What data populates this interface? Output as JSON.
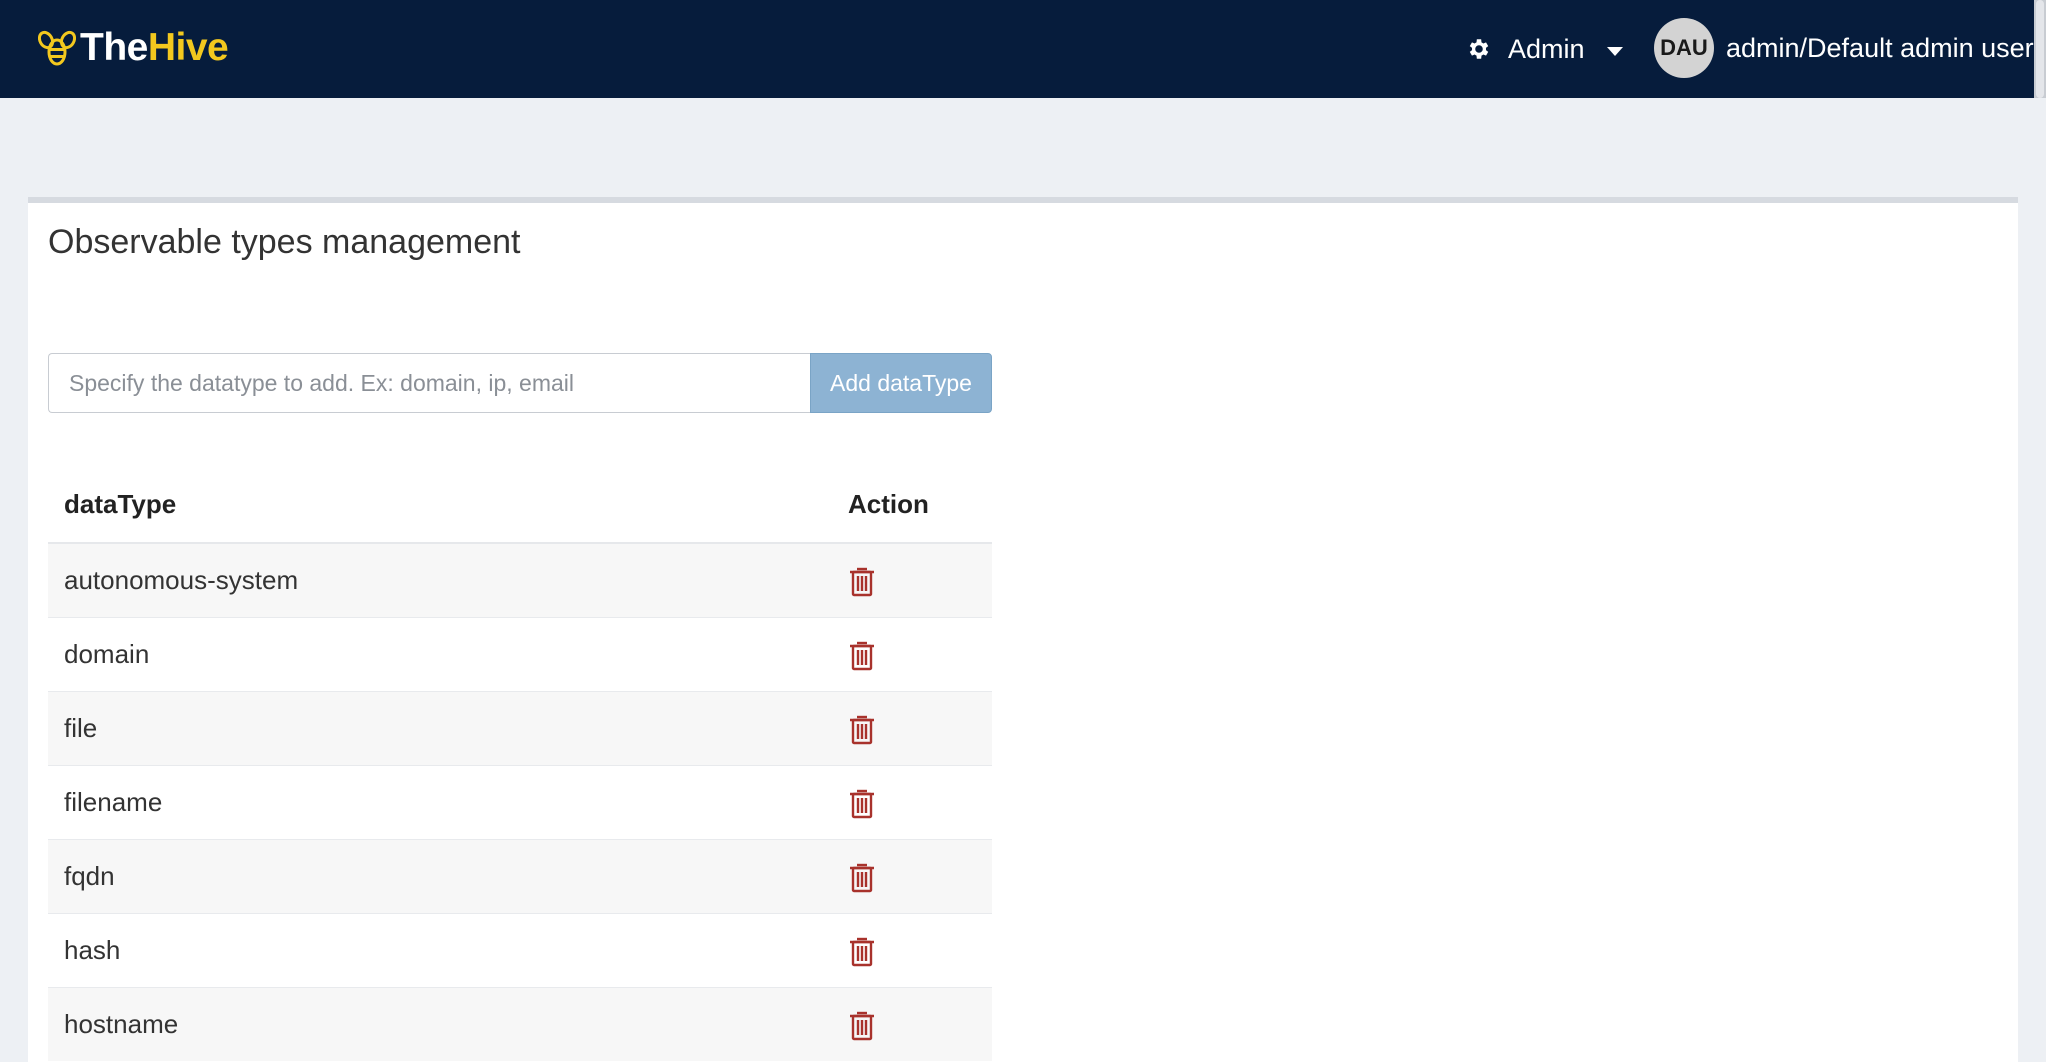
{
  "header": {
    "logo_the": "The",
    "logo_hive": "Hive",
    "admin_label": "Admin",
    "avatar_initials": "DAU",
    "user_name": "admin/Default admin user"
  },
  "page": {
    "title": "Observable types management",
    "input_placeholder": "Specify the datatype to add. Ex: domain, ip, email",
    "input_value": "",
    "add_button_label": "Add dataType"
  },
  "table": {
    "headers": {
      "datatype": "dataType",
      "action": "Action"
    },
    "rows": [
      {
        "datatype": "autonomous-system"
      },
      {
        "datatype": "domain"
      },
      {
        "datatype": "file"
      },
      {
        "datatype": "filename"
      },
      {
        "datatype": "fqdn"
      },
      {
        "datatype": "hash"
      },
      {
        "datatype": "hostname"
      }
    ]
  },
  "colors": {
    "header_bg": "#061c3c",
    "logo_accent": "#f3c81e",
    "button_bg": "#8db3d3",
    "delete_icon": "#a8322c"
  },
  "icons": {
    "gear": "gear-icon",
    "caret": "caret-down-icon",
    "delete": "trash-icon",
    "logo": "bee-logo-icon"
  }
}
